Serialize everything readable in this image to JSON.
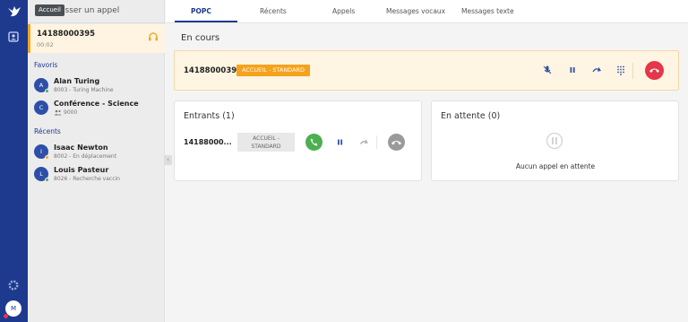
{
  "search": {
    "placeholder": "Passer un appel",
    "tooltip": "Accueil"
  },
  "active_call": {
    "number": "14188000395",
    "duration": "00:02"
  },
  "sidebar": {
    "favorites_label": "Favoris",
    "favorites": [
      {
        "initial": "A",
        "name": "Alan Turing",
        "detail": "8003 - Turing Machine",
        "status_color": "#4caf50"
      },
      {
        "initial": "C",
        "name": "Conférence - Science",
        "detail": "9000"
      }
    ],
    "recents_label": "Récents",
    "recents": [
      {
        "initial": "I",
        "name": "Isaac Newton",
        "detail": "8002 - En déplacement",
        "status_color": "#f5a623"
      },
      {
        "initial": "L",
        "name": "Louis Pasteur",
        "detail": "8026 - Recherche vaccin",
        "status_color": "#4caf50"
      }
    ]
  },
  "tabs": [
    "POPC",
    "Récents",
    "Appels",
    "Messages vocaux",
    "Messages texte"
  ],
  "main": {
    "title": "En cours",
    "current_call": {
      "number": "14188000395",
      "queue": "ACCUEIL - STANDARD"
    },
    "incoming": {
      "title": "Entrants (1)",
      "number": "14188000...",
      "queue_line1": "ACCUEIL -",
      "queue_line2": "STANDARD"
    },
    "waiting": {
      "title": "En attente (0)",
      "empty": "Aucun appel en attente"
    }
  },
  "user": {
    "initial": "M"
  },
  "colors": {
    "brand": "#1d3a8f",
    "accent": "#f5a623",
    "hangup": "#e5364a",
    "answer": "#4caf50"
  }
}
